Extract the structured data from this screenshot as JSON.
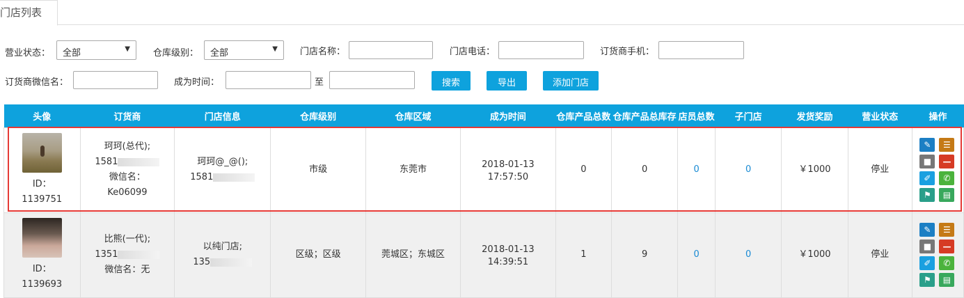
{
  "tab": {
    "label": "门店列表"
  },
  "filters": {
    "business_status_label": "营业状态：",
    "business_status_value": "全部",
    "warehouse_level_label": "仓库级别：",
    "warehouse_level_value": "全部",
    "store_name_label": "门店名称：",
    "store_phone_label": "门店电话：",
    "dealer_phone_label": "订货商手机：",
    "dealer_wechat_label": "订货商微信名：",
    "since_label": "成为时间：",
    "to_label": "至",
    "search_btn": "搜索",
    "export_btn": "导出",
    "add_btn": "添加门店"
  },
  "table": {
    "headers": [
      "头像",
      "订货商",
      "门店信息",
      "仓库级别",
      "仓库区域",
      "成为时间",
      "仓库产品总数",
      "仓库产品总库存",
      "店员总数",
      "子门店",
      "发货奖励",
      "营业状态",
      "操作"
    ],
    "rows": [
      {
        "id_label": "ID：",
        "id": "1139751",
        "dealer_name": "珂珂(总代);",
        "dealer_phone": "1581",
        "dealer_wechat_label": "微信名：",
        "dealer_wechat": "Ke06099",
        "store_name": "珂珂@_@();",
        "store_phone": "1581",
        "level": "市级",
        "area": "东莞市",
        "date": "2018-01-13",
        "time": "17:57:50",
        "product_total": "0",
        "stock_total": "0",
        "staff_total": "0",
        "sub_stores": "0",
        "reward": "￥1000",
        "status": "停业"
      },
      {
        "id_label": "ID：",
        "id": "1139693",
        "dealer_name": "比熊(一代);",
        "dealer_phone": "1351",
        "dealer_wechat_label": "微信名：",
        "dealer_wechat": "无",
        "store_name": "以纯门店;",
        "store_phone": "135",
        "level": "区级；区级",
        "area": "莞城区；东城区",
        "date": "2018-01-13",
        "time": "14:39:51",
        "product_total": "1",
        "stock_total": "9",
        "staff_total": "0",
        "sub_stores": "0",
        "reward": "￥1000",
        "status": "停业"
      }
    ]
  },
  "icons": [
    "edit-icon",
    "list-icon",
    "lock-icon",
    "minus-icon",
    "pencil-icon",
    "phone-icon",
    "flag-icon",
    "report-icon"
  ]
}
